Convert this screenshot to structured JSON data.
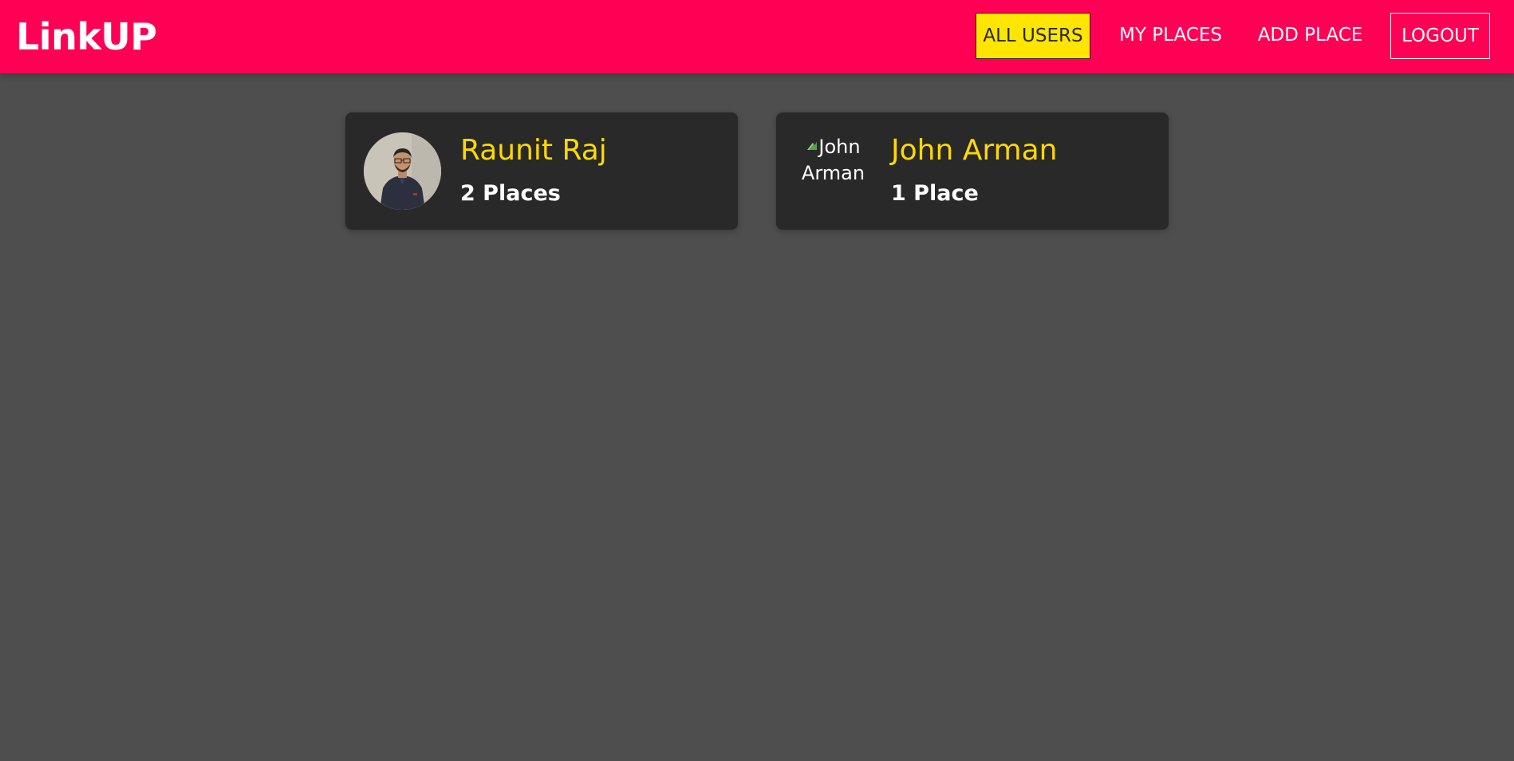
{
  "header": {
    "logo": "LinkUP",
    "nav": {
      "all_users": "ALL USERS",
      "my_places": "MY PLACES",
      "add_place": "ADD PLACE",
      "logout": "LOGOUT"
    },
    "active_nav": "all_users",
    "colors": {
      "bar": "#ff0055",
      "active_bg": "#ffe500"
    }
  },
  "users": [
    {
      "name": "Raunit Raj",
      "places": "2 Places",
      "avatar_icon": "user-photo"
    },
    {
      "name": "John Arman",
      "places": "1 Place",
      "avatar_alt": "John Arman",
      "avatar_icon": "broken-image-icon"
    }
  ],
  "colors": {
    "page_bg": "#4e4e4e",
    "card_bg": "#292929",
    "name": "#ffd900",
    "places": "#ffffff"
  }
}
